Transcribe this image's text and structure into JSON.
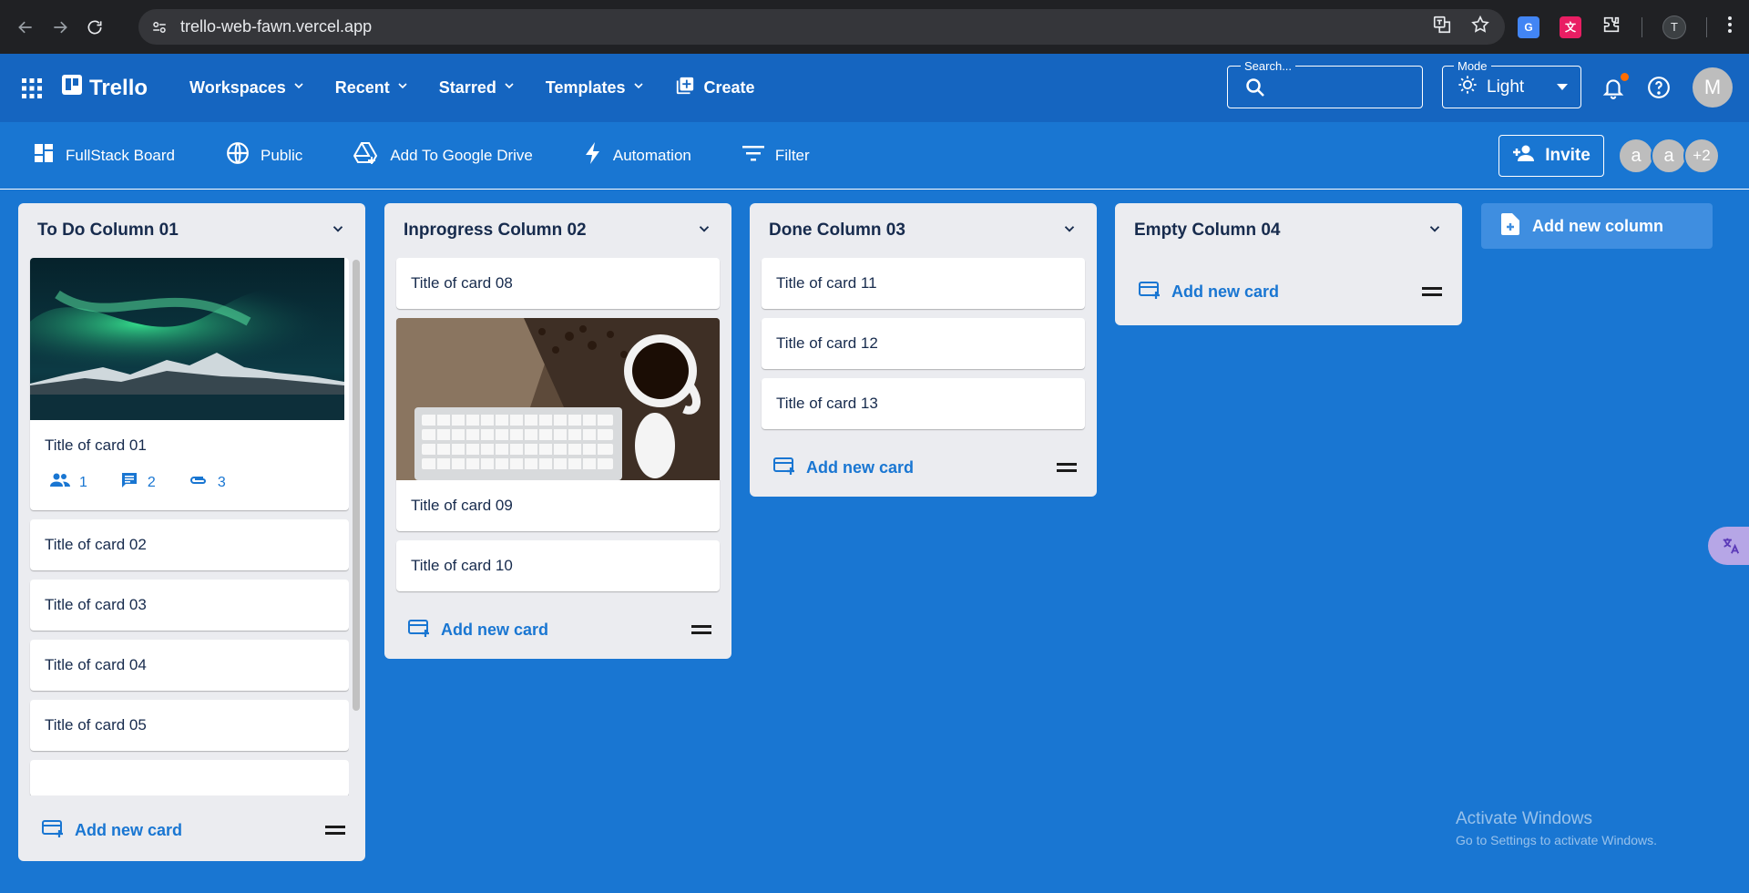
{
  "browser": {
    "url": "trello-web-fawn.vercel.app",
    "profile_initial": "T"
  },
  "app": {
    "brand": "Trello",
    "nav": [
      {
        "label": "Workspaces"
      },
      {
        "label": "Recent"
      },
      {
        "label": "Starred"
      },
      {
        "label": "Templates"
      }
    ],
    "create_label": "Create",
    "search": {
      "label": "Search...",
      "placeholder": ""
    },
    "mode": {
      "label": "Mode",
      "value": "Light"
    },
    "user_initial": "M"
  },
  "board_bar": {
    "board_name": "FullStack Board",
    "visibility": "Public",
    "drive": "Add To Google Drive",
    "automation": "Automation",
    "filter": "Filter",
    "invite": "Invite",
    "members": [
      "a",
      "a",
      "+2"
    ]
  },
  "columns": [
    {
      "title": "To Do Column 01",
      "cards": [
        {
          "title": "Title of card 01",
          "image": "aurora",
          "members": "1",
          "comments": "2",
          "attachments": "3"
        },
        {
          "title": "Title of card 02"
        },
        {
          "title": "Title of card 03"
        },
        {
          "title": "Title of card 04"
        },
        {
          "title": "Title of card 05"
        }
      ],
      "add_label": "Add new card"
    },
    {
      "title": "Inprogress Column 02",
      "cards": [
        {
          "title": "Title of card 08"
        },
        {
          "title": "Title of card 09",
          "image": "keyboard-coffee"
        },
        {
          "title": "Title of card 10"
        }
      ],
      "add_label": "Add new card"
    },
    {
      "title": "Done Column 03",
      "cards": [
        {
          "title": "Title of card 11"
        },
        {
          "title": "Title of card 12"
        },
        {
          "title": "Title of card 13"
        }
      ],
      "add_label": "Add new card"
    },
    {
      "title": "Empty Column 04",
      "cards": [],
      "add_label": "Add new card"
    }
  ],
  "add_column_label": "Add new column",
  "watermark": {
    "line1": "Activate Windows",
    "line2": "Go to Settings to activate Windows."
  },
  "colors": {
    "board_bg": "#1976d2",
    "appbar_bg": "#1565c0",
    "column_bg": "#ebecf0",
    "accent": "#1976d2"
  }
}
